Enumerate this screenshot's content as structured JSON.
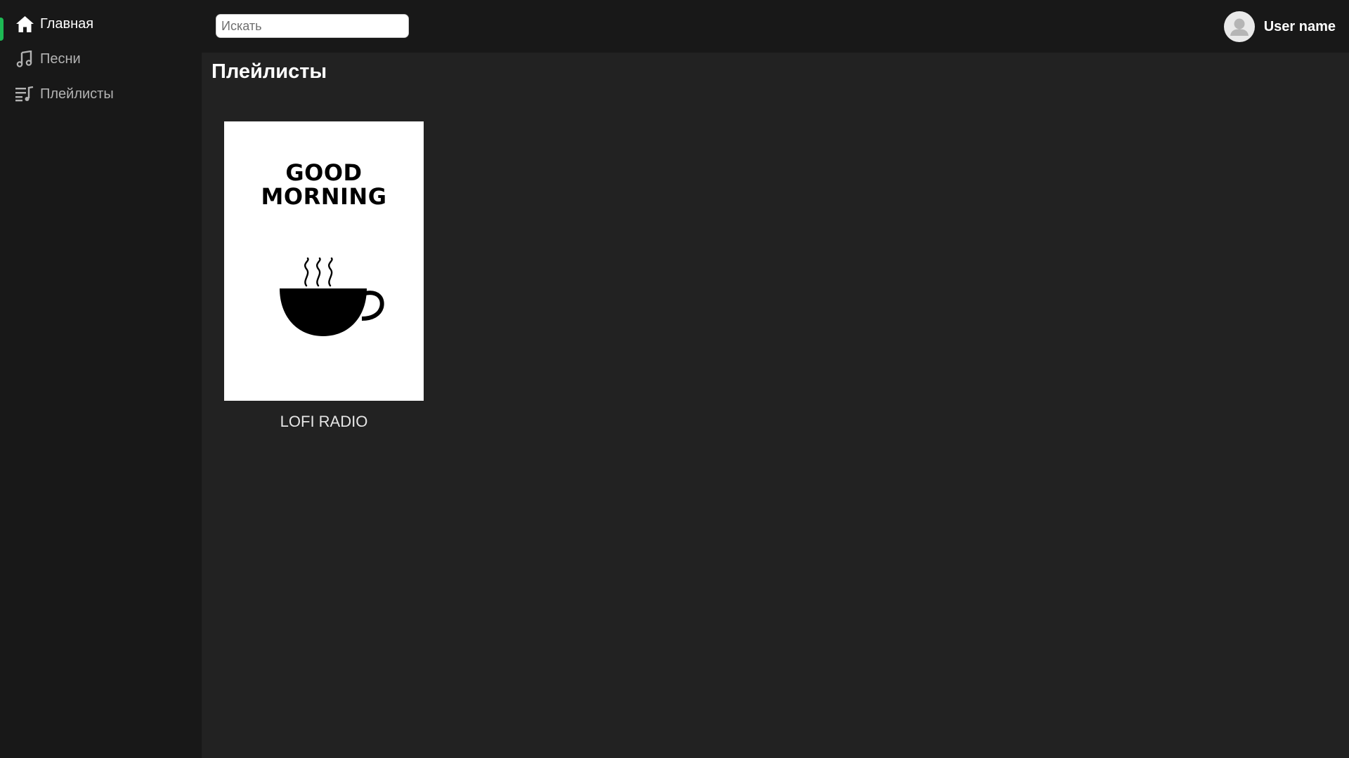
{
  "sidebar": {
    "items": [
      {
        "label": "Главная",
        "icon": "home-icon",
        "active": true
      },
      {
        "label": "Песни",
        "icon": "music-note-icon",
        "active": false
      },
      {
        "label": "Плейлисты",
        "icon": "playlist-icon",
        "active": false
      }
    ]
  },
  "header": {
    "search_placeholder": "Искать",
    "user_name": "User name",
    "avatar_icon": "user-avatar-icon"
  },
  "main": {
    "title": "Плейлисты",
    "playlists": [
      {
        "title": "LOFI RADIO",
        "cover_text": "GOOD MORNING",
        "cover_icon": "coffee-cup-icon"
      }
    ]
  },
  "colors": {
    "accent": "#1db954",
    "sidebar_bg": "#181818",
    "main_bg": "#222222"
  }
}
